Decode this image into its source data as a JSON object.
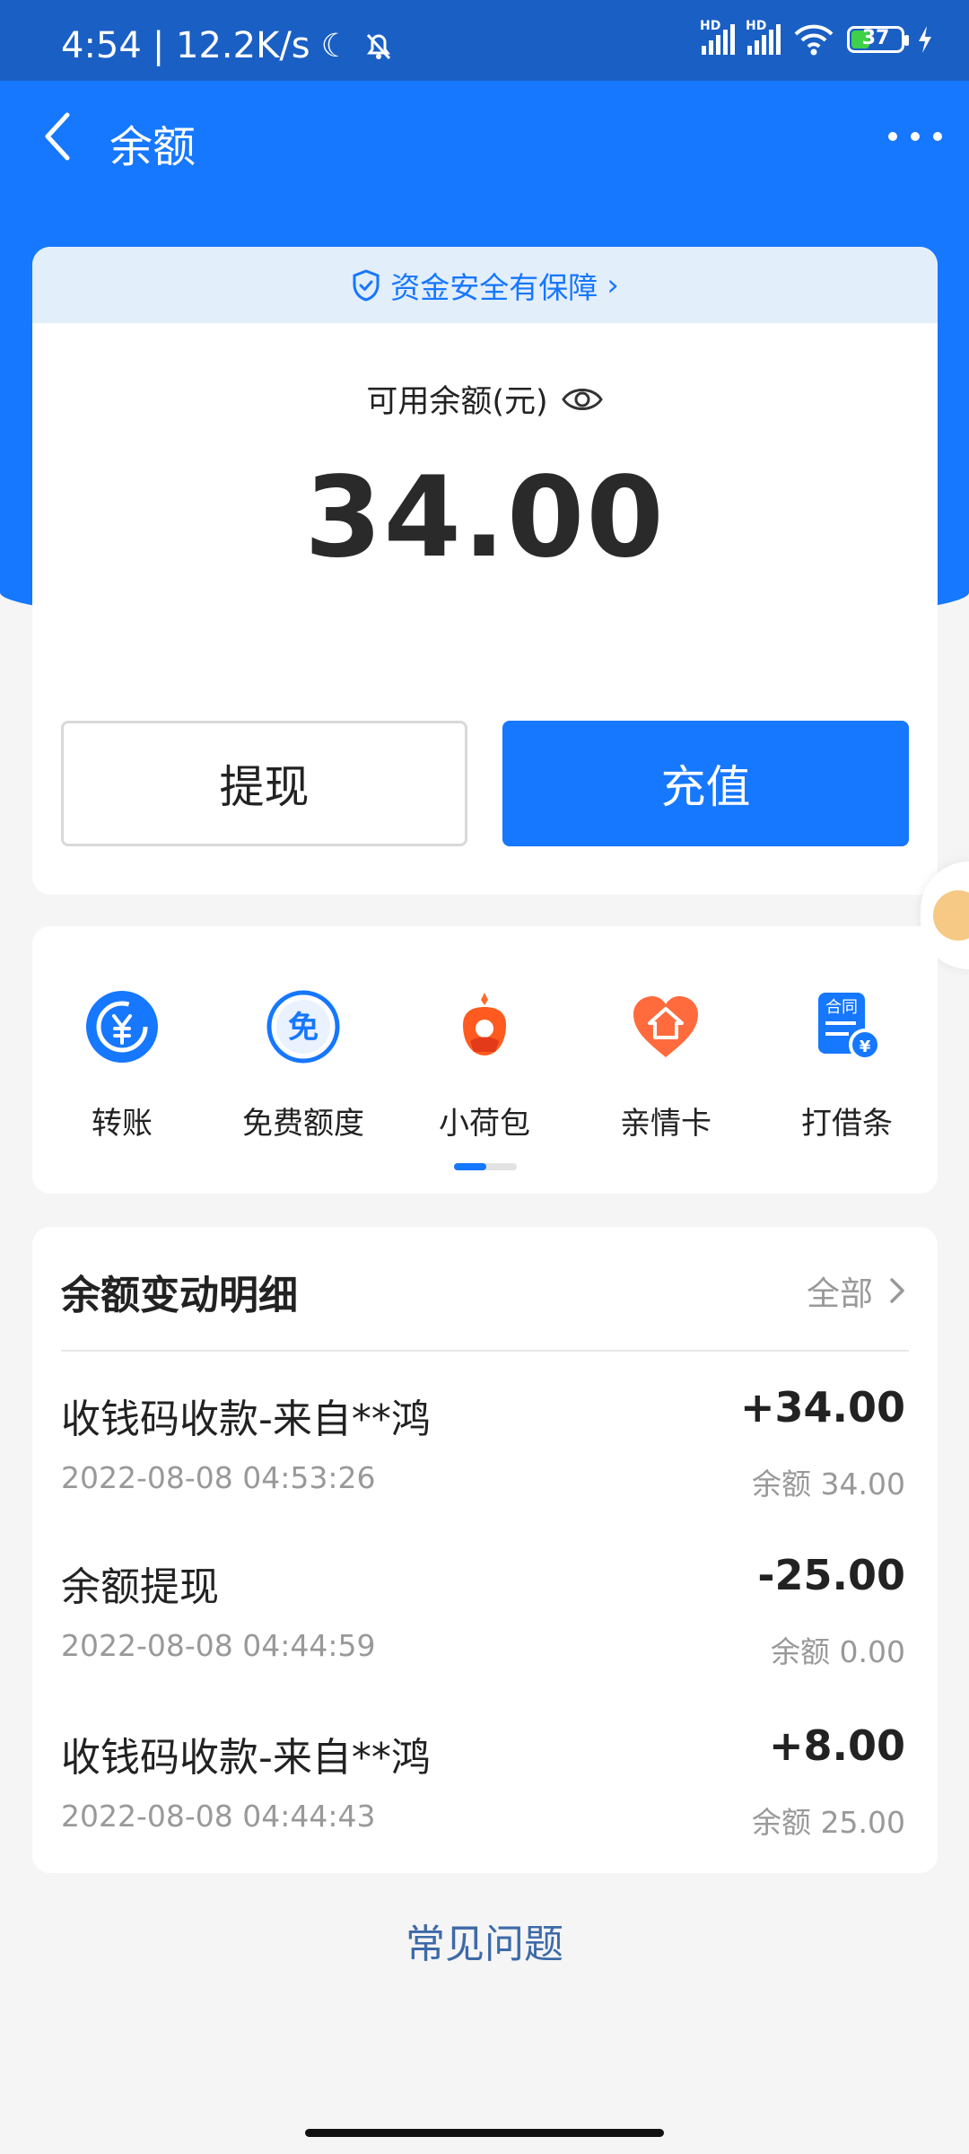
{
  "status_bar": {
    "time": "4:54",
    "net_speed": "| 12.2K/s",
    "battery": "37",
    "hd1": "HD",
    "hd2": "HD"
  },
  "nav": {
    "title": "余额"
  },
  "balance": {
    "safety_text": "资金安全有保障",
    "label": "可用余额(元)",
    "amount": "34.00",
    "withdraw_label": "提现",
    "recharge_label": "充值"
  },
  "services": [
    {
      "label": "转账",
      "icon": "yuan-transfer-icon"
    },
    {
      "label": "免费额度",
      "icon": "free-quota-icon"
    },
    {
      "label": "小荷包",
      "icon": "small-purse-icon"
    },
    {
      "label": "亲情卡",
      "icon": "family-card-icon"
    },
    {
      "label": "打借条",
      "icon": "iou-contract-icon"
    }
  ],
  "detail": {
    "title": "余额变动明细",
    "all_label": "全部",
    "transactions": [
      {
        "name": "收钱码收款-来自**鸿",
        "time": "2022-08-08 04:53:26",
        "amount": "+34.00",
        "balance": "余额 34.00"
      },
      {
        "name": "余额提现",
        "time": "2022-08-08 04:44:59",
        "amount": "-25.00",
        "balance": "余额 0.00"
      },
      {
        "name": "收钱码收款-来自**鸿",
        "time": "2022-08-08 04:44:43",
        "amount": "+8.00",
        "balance": "余额 25.00"
      }
    ]
  },
  "faq_label": "常见问题",
  "colors": {
    "primary": "#1677ff",
    "status_bar": "#1a5fc4",
    "safety_bg": "#e3eefb",
    "faq": "#3d6aa8"
  }
}
